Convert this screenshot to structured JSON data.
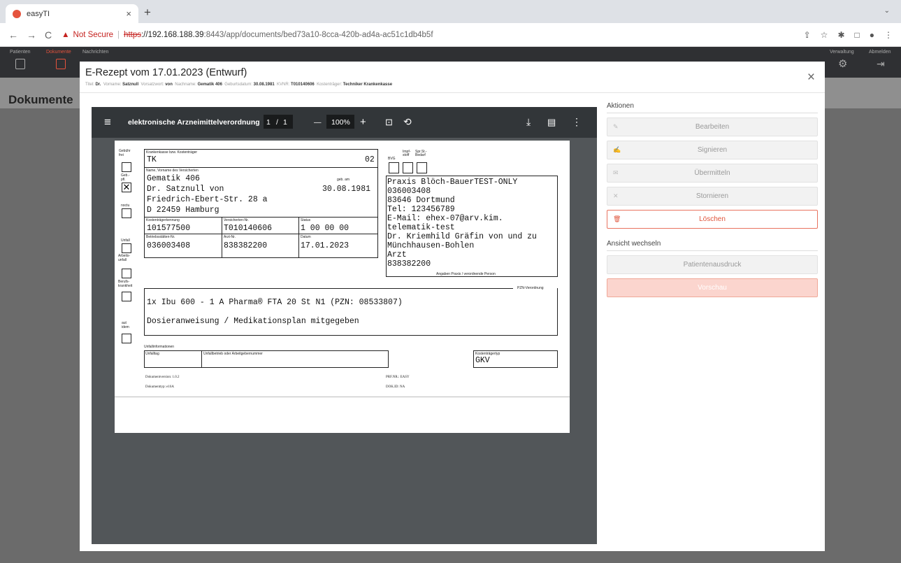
{
  "browser": {
    "tab_title": "easyTI",
    "tab_close": "×",
    "new_tab": "+",
    "tab_menu": "⌄",
    "back": "←",
    "forward": "→",
    "reload": "C",
    "warning_icon": "▲",
    "not_secure": "Not Secure",
    "separator": "|",
    "scheme": "https",
    "host": "://192.168.188.39",
    "path": ":8443/app/documents/bed73a10-8cca-420b-ad4a-ac51c1db4b5f",
    "toolbar_icons": [
      "⇪",
      "☆",
      "✱",
      "□",
      "●",
      "⋮"
    ]
  },
  "app": {
    "nav_left": [
      "Patienten",
      "Dokumente",
      "Nachrichten"
    ],
    "nav_right": [
      "Verwaltung",
      "Abmelden"
    ],
    "settings_icon": "⚙",
    "logout_icon": "⇥",
    "page_title": "Dokumente"
  },
  "modal": {
    "title": "E-Rezept vom 17.01.2023 (Entwurf)",
    "close": "×",
    "meta": {
      "titel_label": "Titel:",
      "titel_value": "Dr.",
      "vorname_label": "Vorname:",
      "vorname_value": "Satznull",
      "vorsatz_label": "Vorsatzwort:",
      "vorsatz_value": "von",
      "nachname_label": "Nachname:",
      "nachname_value": "Gematik 406",
      "geb_label": "Geburtsdatum:",
      "geb_value": "30.08.1981",
      "kvnr_label": "KVNR:",
      "kvnr_value": "T010140606",
      "kt_label": "Kostenträger:",
      "kt_value": "Techniker Krankenkasse"
    }
  },
  "viewer": {
    "menu_icon": "≡",
    "title": "elektronische Arzneimittelverordnung",
    "page_current": "1",
    "page_sep": "/",
    "page_total": "1",
    "zoom_minus": "—",
    "zoom": "100%",
    "zoom_plus": "+",
    "fit_icon": "⊡",
    "rotate_icon": "⟲",
    "download_icon": "⤓",
    "print_icon": "▤",
    "more_icon": "⋮"
  },
  "form": {
    "l_gebuehr": "Gebühr frei",
    "l_gebpfl": "Geb.-pfl.",
    "l_noctu": "noctu",
    "l_unfall": "Unfall",
    "l_arbeit": "Arbeits-unfall",
    "l_beruf": "Berufs-krankheit",
    "l_autidem": "aut idem",
    "check_x": "✕",
    "l_kk": "Krankenkasse bzw. Kostenträger",
    "kk": "TK",
    "kk_nr": "02",
    "l_name": "Name, Vorname des Versicherten",
    "l_gebam": "geb. am",
    "name1": "Gematik 406",
    "name2": "Dr. Satznull von",
    "gebdat": "30.08.1981",
    "strasse": "Friedrich-Ebert-Str. 28 a",
    "ort": "D 22459 Hamburg",
    "l_ktk": "Kostenträgerkennung",
    "l_vnr": "Versicherten-Nr.",
    "l_status": "Status",
    "ktk": "101577500",
    "vnr": "T010140606",
    "status": "1 00 00 00",
    "l_bsnr": "Betriebsstätten-Nr.",
    "l_arzt": "Arzt-Nr.",
    "l_datum": "Datum",
    "bsnr": "036003408",
    "arztnr": "838382200",
    "datum": "17.01.2023",
    "l_impf": "Impf-stoff",
    "l_sprst": "Spr.St.-Bedarf",
    "l_bvg": "BVG",
    "praxis": [
      "Praxis Blöch-BauerTEST-ONLY",
      "036003408",
      "83646 Dortmund",
      "Tel: 123456789",
      "E-Mail: ehex-07@arv.kim.",
      "telematik-test",
      "Dr. Kriemhild Gräfin von und zu",
      "Münchhausen-Bohlen",
      "Arzt",
      "838382200"
    ],
    "l_praxis": "Angaben Praxis / verordnende Person",
    "l_pzn": "PZN-Verordnung",
    "verordnung": "1x Ibu 600 - 1 A Pharma® FTA 20 St N1 (PZN: 08533807)",
    "dosierung": "Dosieranweisung / Medikationsplan mitgegeben",
    "l_unfallinfo": "Unfallinformationen",
    "l_unfalltag": "Unfalltag",
    "l_unfallbetrieb": "Unfallbetrieb oder Arbeitgebernummer",
    "l_kttyp": "Kostenträgertyp",
    "kttyp": "GKV",
    "dokver": "Dokumentversion: 1.0.2",
    "doktyp": "Dokumenttyp: e16A",
    "prfnr": "PRF.NR.: EASY",
    "dokid": "DOK.ID: NA"
  },
  "actions": {
    "header": "Aktionen",
    "edit": "Bearbeiten",
    "edit_icon": "✎",
    "sign": "Signieren",
    "sign_icon": "✍",
    "send": "Übermitteln",
    "send_icon": "✉",
    "cancel": "Stornieren",
    "cancel_icon": "✕",
    "delete": "Löschen",
    "delete_icon": "🗑",
    "view_header": "Ansicht wechseln",
    "patient_print": "Patientenausdruck",
    "preview": "Vorschau"
  }
}
